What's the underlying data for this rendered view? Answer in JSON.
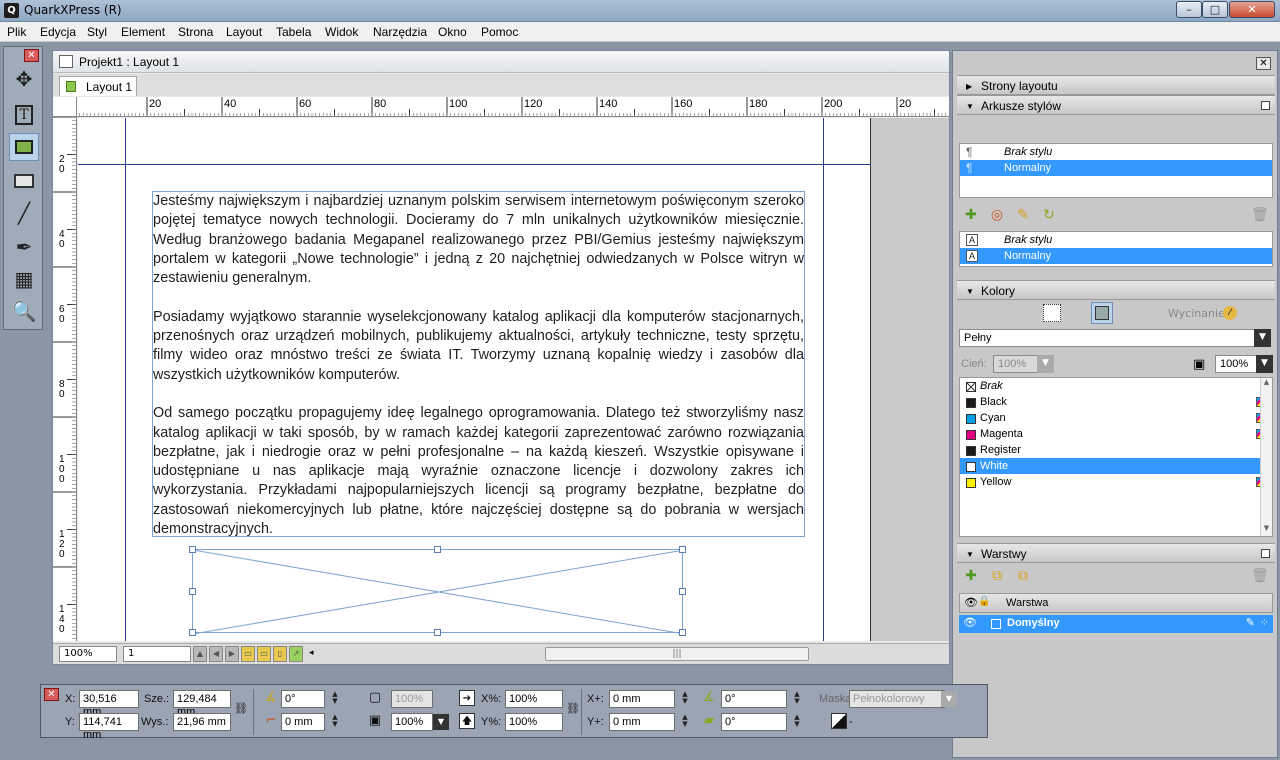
{
  "app": {
    "title": "QuarkXPress (R)",
    "icon": "Q"
  },
  "window_controls": {
    "minimize": "–",
    "maximize": "□",
    "close": "✕"
  },
  "menu": [
    "Plik",
    "Edycja",
    "Styl",
    "Element",
    "Strona",
    "Layout",
    "Tabela",
    "Widok",
    "Narzędzia",
    "Okno",
    "Pomoc"
  ],
  "document": {
    "title": "Projekt1 : Layout 1",
    "tab": "Layout 1",
    "ruler_h": [
      "20",
      "40",
      "60",
      "80",
      "100",
      "120",
      "140",
      "160",
      "180",
      "200",
      "20"
    ],
    "ruler_v": [
      [
        "2",
        "0"
      ],
      [
        "4",
        "0"
      ],
      [
        "6",
        "0"
      ],
      [
        "8",
        "0"
      ],
      [
        "1",
        "0",
        "0"
      ],
      [
        "1",
        "2",
        "0"
      ],
      [
        "1",
        "4",
        "0"
      ]
    ],
    "paragraphs": [
      "Jesteśmy największym i najbardziej uznanym polskim serwisem internetowym poświęconym szeroko pojętej tematyce nowych technologii. Docieramy do 7 mln unikalnych użytkowników miesięcznie. Według branżowego badania Megapanel realizowanego przez PBI/Gemius jesteśmy największym portalem w kategorii „Nowe technologie” i jedną z 20 najchętniej odwiedzanych w Polsce witryn w zestawieniu generalnym.",
      "Posiadamy wyjątkowo starannie wyselekcjonowany katalog aplikacji dla komputerów stacjonarnych, przenośnych oraz urządzeń mobilnych, publikujemy aktualności, artykuły techniczne, testy sprzętu, filmy wideo oraz mnóstwo treści ze świata IT. Tworzymy uznaną kopalnię wiedzy i zasobów dla wszystkich użytkowników komputerów.",
      "Od samego początku propagujemy ideę legalnego oprogramowania. Dlatego też stworzyliśmy nasz katalog aplikacji w taki sposób, by w ramach każdej kategorii zaprezentować zarówno rozwiązania bezpłatne, jak i niedrogie oraz w pełni profesjonalne – na każdą kieszeń. Wszystkie opisywane i udostępniane u nas aplikacje mają wyraźnie oznaczone licencje i dozwolony zakres ich wykorzystania. Przykładami najpopularniejszych licencji są programy bezpłatne, bezpłatne do zastosowań niekomercyjnych lub płatne, które najczęściej dostępne są do pobrania w wersjach demonstracyjnych."
    ],
    "zoom": "100%",
    "page": "1"
  },
  "palette": {
    "strony": "Strony layoutu",
    "arkusze": "Arkusze stylów",
    "para_styles": [
      {
        "name": "Brak stylu",
        "sel": false
      },
      {
        "name": "Normalny",
        "sel": true
      }
    ],
    "char_styles": [
      {
        "name": "Brak stylu",
        "sel": false
      },
      {
        "name": "Normalny",
        "sel": true
      }
    ],
    "kolory": "Kolory",
    "wycinanie": "Wycinanie",
    "fill_type": "Pełny",
    "cien_label": "Cień:",
    "cien_value": "100%",
    "opacity": "100%",
    "colors": [
      {
        "name": "Brak",
        "swatch": "none",
        "model": false,
        "sel": false
      },
      {
        "name": "Black",
        "swatch": "#1a1a1a",
        "model": true,
        "sel": false
      },
      {
        "name": "Cyan",
        "swatch": "#00a0e9",
        "model": true,
        "sel": false
      },
      {
        "name": "Magenta",
        "swatch": "#e4007f",
        "model": true,
        "sel": false
      },
      {
        "name": "Register",
        "swatch": "#1a1a1a",
        "model": false,
        "sel": false
      },
      {
        "name": "White",
        "swatch": "#ffffff",
        "model": false,
        "sel": true
      },
      {
        "name": "Yellow",
        "swatch": "#fff100",
        "model": true,
        "sel": false
      }
    ],
    "warstwy": "Warstwy",
    "layer_header": "Warstwa",
    "layer_name": "Domyślny"
  },
  "measure": {
    "x_label": "X:",
    "x": "30,516 mm",
    "y_label": "Y:",
    "y": "114,741 mm",
    "w_label": "Sze.:",
    "w": "129,484 mm",
    "h_label": "Wys.:",
    "h": "21,96 mm",
    "angle": "0°",
    "corner": "0 mm",
    "fill_opacity": "100%",
    "frame_opacity": "100%",
    "xscale_label": "X%:",
    "xscale": "100%",
    "yscale_label": "Y%:",
    "yscale": "100%",
    "xoff_label": "X+:",
    "xoff": "0 mm",
    "yoff_label": "Y+:",
    "yoff": "0 mm",
    "pic_angle": "0°",
    "pic_skew": "0°",
    "mask_label": "Maska:",
    "mask": "Pełnokolorowy"
  },
  "colors": {
    "selection": "#3399ff",
    "guide": "#2c3a8f",
    "frame": "#7ea3d3"
  }
}
